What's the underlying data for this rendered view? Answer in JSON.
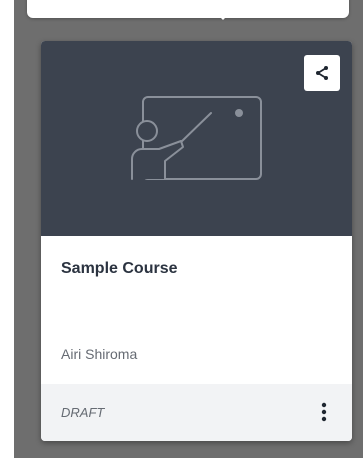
{
  "card": {
    "title": "Sample Course",
    "author": "Airi Shiroma",
    "status": "DRAFT",
    "media_icon": "teacher-presentation-icon",
    "share_icon": "share-icon",
    "menu_icon": "more-vertical-icon"
  },
  "colors": {
    "media_background": "#3c434f",
    "panel_background": "#6e6e6e",
    "footer_background": "#f2f3f5"
  }
}
